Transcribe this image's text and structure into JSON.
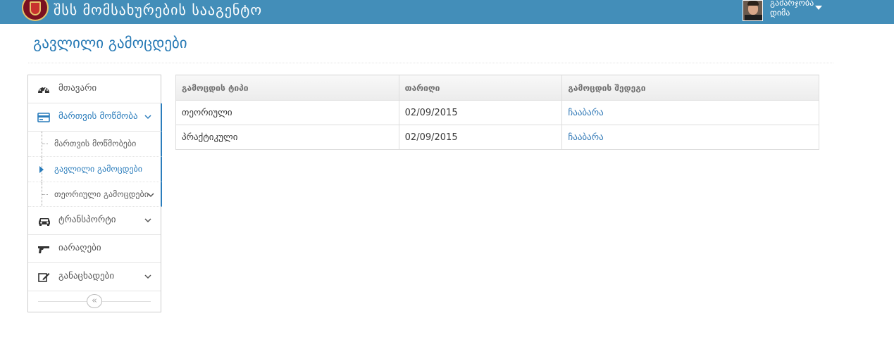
{
  "header": {
    "brand": "შსს მომსახურების სააგენტო",
    "user_greeting": "გამარჯობა",
    "user_name": "დიმა",
    "logo_icon": "emblem-logo",
    "user_menu_icon": "caret-down-icon",
    "bar_color": "#438eb9"
  },
  "page": {
    "title": "გავლილი გამოცდები"
  },
  "sidebar": {
    "items": [
      {
        "label": "მთავარი",
        "icon": "dashboard-icon"
      },
      {
        "label": "მართვის მოწმობა",
        "icon": "credit-card-icon",
        "expanded": true
      },
      {
        "label": "ტრანსპორტი",
        "icon": "car-icon"
      },
      {
        "label": "იარაღები",
        "icon": "pistol-icon"
      },
      {
        "label": "განაცხადები",
        "icon": "edit-icon"
      }
    ],
    "subitems": [
      {
        "label": "მართვის მოწმობები"
      },
      {
        "label": "გავლილი გამოცდები",
        "current": true
      },
      {
        "label": "თეორიული გამოცდები"
      }
    ],
    "collapse_icon": "double-chevron-left-icon",
    "accent": "#2b7dbc"
  },
  "table": {
    "columns": [
      "გამოცდის ტიპი",
      "თარიღი",
      "გამოცდის შედეგი"
    ],
    "rows": [
      {
        "type": "თეორიული",
        "date": "02/09/2015",
        "result": "ჩააბარა"
      },
      {
        "type": "პრაქტიკული",
        "date": "02/09/2015",
        "result": "ჩააბარა"
      }
    ]
  }
}
